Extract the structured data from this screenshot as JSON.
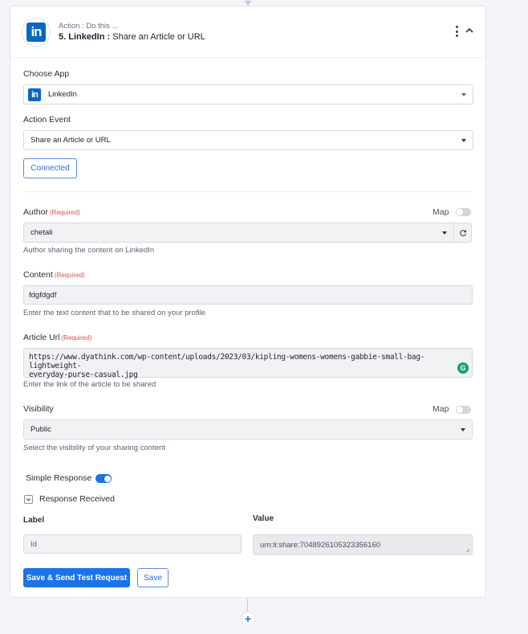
{
  "header": {
    "kicker": "Action : Do this ...",
    "step_number": "5. LinkedIn : ",
    "step_action": "Share an Article or URL",
    "app_logo_text": "in"
  },
  "choose_app": {
    "label": "Choose App",
    "value": "LinkedIn"
  },
  "action_event": {
    "label": "Action Event",
    "value": "Share an Article or URL"
  },
  "connected_button": "Connected",
  "author": {
    "label": "Author",
    "required": "(Required)",
    "map_label": "Map",
    "value": "chetali",
    "helper": "Author sharing the content on LinkedIn"
  },
  "content": {
    "label": "Content",
    "required": "(Required)",
    "value": "fdgfdgdf",
    "helper": "Enter the text content that to be shared on your profile"
  },
  "article_url": {
    "label": "Article Url",
    "required": "(Required)",
    "value_line1": "https://www.dyathink.com/wp-content/uploads/2023/03/kipling-womens-womens-gabbie-small-bag-lightweight-",
    "value_line2": "everyday-purse-casual.jpg",
    "helper": "Enter the link of the article to be shared"
  },
  "visibility": {
    "label": "Visibility",
    "map_label": "Map",
    "value": "Public",
    "helper": "Select the visibility of your sharing content"
  },
  "simple_response": {
    "label": "Simple Response",
    "enabled": true
  },
  "response_received": {
    "label": "Response Received",
    "checked": true
  },
  "response_table": {
    "label_header": "Label",
    "value_header": "Value",
    "label_value": "Id",
    "value_value": "urn:li:share:7048926105323356160"
  },
  "actions": {
    "save_and_test": "Save & Send Test Request",
    "save": "Save"
  },
  "add_step_symbol": "+",
  "colors": {
    "accent": "#1a73e8",
    "linkedin": "#0a66c2",
    "required": "#d9534f"
  }
}
